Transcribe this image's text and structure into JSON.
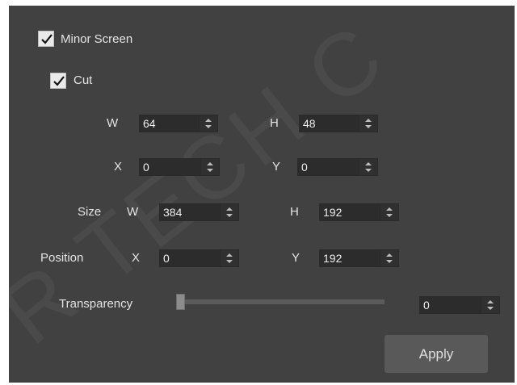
{
  "minor_screen": {
    "label": "Minor Screen",
    "checked": true
  },
  "cut": {
    "label": "Cut",
    "checked": true,
    "w": {
      "label": "W",
      "value": "64"
    },
    "h": {
      "label": "H",
      "value": "48"
    },
    "x": {
      "label": "X",
      "value": "0"
    },
    "y": {
      "label": "Y",
      "value": "0"
    }
  },
  "size": {
    "label": "Size",
    "w": {
      "label": "W",
      "value": "384"
    },
    "h": {
      "label": "H",
      "value": "192"
    }
  },
  "position": {
    "label": "Position",
    "x": {
      "label": "X",
      "value": "0"
    },
    "y": {
      "label": "Y",
      "value": "192"
    }
  },
  "transparency": {
    "label": "Transparency",
    "value": "0",
    "level_fraction": 0
  },
  "apply_label": "Apply"
}
